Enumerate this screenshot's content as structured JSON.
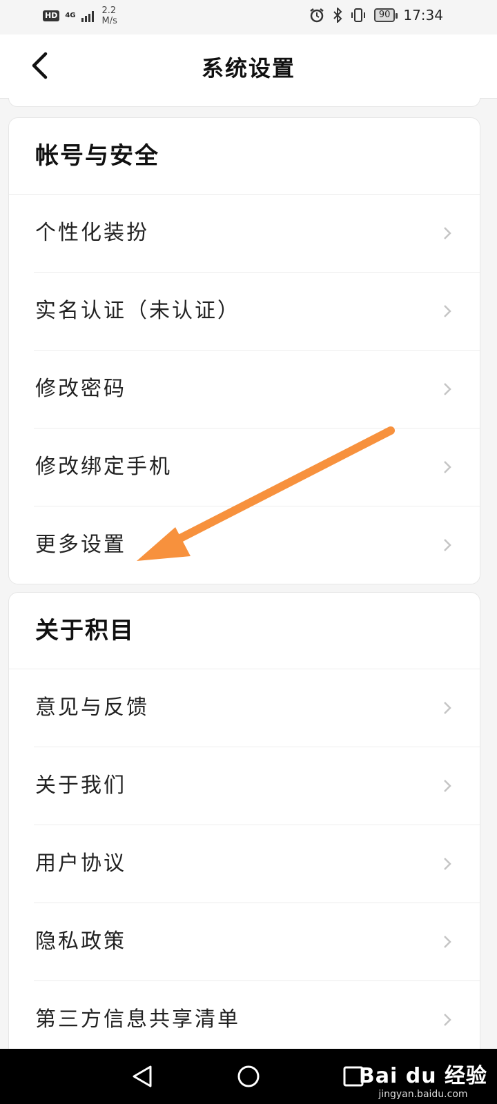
{
  "status_bar": {
    "hd": "HD",
    "network": "4G",
    "speed_value": "2.2",
    "speed_unit": "M/s",
    "battery": "90",
    "time": "17:34",
    "icons": [
      "alarm-icon",
      "bluetooth-icon",
      "vibrate-icon",
      "battery-icon"
    ]
  },
  "header": {
    "title": "系统设置",
    "back_icon": "chevron-left-icon"
  },
  "sections": [
    {
      "title": "帐号与安全",
      "items": [
        {
          "label": "个性化装扮"
        },
        {
          "label": "实名认证（未认证）"
        },
        {
          "label": "修改密码"
        },
        {
          "label": "修改绑定手机"
        },
        {
          "label": "更多设置"
        }
      ]
    },
    {
      "title": "关于积目",
      "items": [
        {
          "label": "意见与反馈"
        },
        {
          "label": "关于我们"
        },
        {
          "label": "用户协议"
        },
        {
          "label": "隐私政策"
        },
        {
          "label": "第三方信息共享清单"
        }
      ]
    }
  ],
  "annotation": {
    "arrow_color": "#f7913d",
    "points_to": "更多设置"
  },
  "nav_bar": {
    "buttons": [
      "back-triangle-icon",
      "home-circle-icon",
      "recents-square-icon"
    ]
  },
  "watermark": {
    "logo": "Bai du 经验",
    "url": "jingyan.baidu.com"
  }
}
